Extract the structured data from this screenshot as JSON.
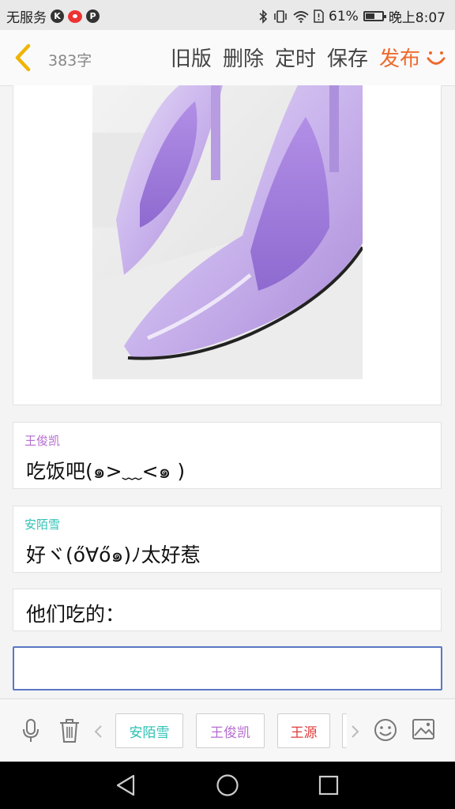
{
  "status_bar": {
    "carrier": "无服务",
    "battery": "61%",
    "battery_level": 0.61,
    "time": "晚上8:07"
  },
  "header": {
    "word_count": "383字",
    "actions": [
      "旧版",
      "删除",
      "定时",
      "保存"
    ],
    "publish": "发布"
  },
  "messages": [
    {
      "name": "王俊凯",
      "name_color": "#b56ccf",
      "text": "吃饭吧(๑>﹏<๑ )"
    },
    {
      "name": "安陌雪",
      "name_color": "#2ec2b4",
      "text": "好ヾ(ő∀ő๑)ﾉ太好惹"
    },
    {
      "name": "",
      "text": "他们吃的："
    }
  ],
  "toolbar": {
    "tags": [
      {
        "label": "安陌雪",
        "color": "#2ec2b4"
      },
      {
        "label": "王俊凯",
        "color": "#b56ccf"
      },
      {
        "label": "王源",
        "color": "#e03c3c"
      }
    ]
  },
  "colors": {
    "accent": "#ee6a2d",
    "input_border": "#5b77c4"
  }
}
